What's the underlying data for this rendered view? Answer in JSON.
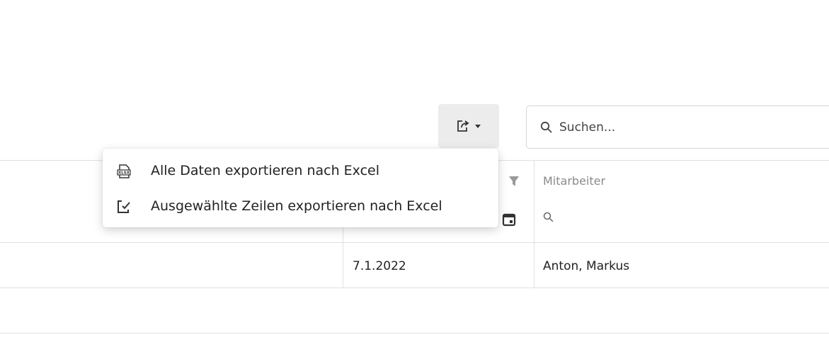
{
  "toolbar": {
    "export_icon": "export-icon",
    "search": {
      "placeholder": "Suchen...",
      "value": ""
    }
  },
  "export_menu": {
    "items": [
      {
        "label": "Alle Daten exportieren nach Excel",
        "icon": "xlsx-file-icon"
      },
      {
        "label": "Ausgewählte Zeilen exportieren nach Excel",
        "icon": "selected-rows-icon"
      }
    ]
  },
  "table": {
    "columns": [
      {
        "header": "",
        "filter_icon": "funnel-icon",
        "filter_control_icon": "calendar-icon"
      },
      {
        "header": "Mitarbeiter",
        "filter_control_icon": "search-icon"
      }
    ],
    "rows": [
      {
        "date": "7.1.2022",
        "employee": "Anton, Markus"
      }
    ]
  }
}
